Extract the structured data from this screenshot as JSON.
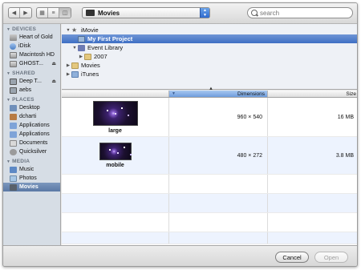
{
  "toolbar": {
    "location": "Movies",
    "search_placeholder": "search"
  },
  "sidebar": {
    "sections": [
      {
        "title": "DEVICES",
        "items": [
          {
            "label": "Heart of Gold",
            "icon": "drive-icon"
          },
          {
            "label": "iDisk",
            "icon": "idisk-icon"
          },
          {
            "label": "Macintosh HD",
            "icon": "hard-drive-icon"
          },
          {
            "label": "GHOST...",
            "icon": "hard-drive-icon",
            "eject": true
          }
        ]
      },
      {
        "title": "SHARED",
        "items": [
          {
            "label": "Deep T...",
            "icon": "network-computer-icon",
            "eject": true
          },
          {
            "label": "aebs",
            "icon": "network-icon"
          }
        ]
      },
      {
        "title": "PLACES",
        "items": [
          {
            "label": "Desktop",
            "icon": "desktop-icon"
          },
          {
            "label": "dcharti",
            "icon": "home-icon"
          },
          {
            "label": "Applications",
            "icon": "applications-icon"
          },
          {
            "label": "Applications",
            "icon": "applications-icon"
          },
          {
            "label": "Documents",
            "icon": "documents-icon"
          },
          {
            "label": "Quicksilver",
            "icon": "quicksilver-icon"
          }
        ]
      },
      {
        "title": "MEDIA",
        "items": [
          {
            "label": "Music",
            "icon": "music-icon"
          },
          {
            "label": "Photos",
            "icon": "photos-icon"
          },
          {
            "label": "Movies",
            "icon": "movies-icon",
            "selected": true
          }
        ]
      }
    ]
  },
  "tree": {
    "rows": [
      {
        "label": "iMovie",
        "indent": 0,
        "expanded": true,
        "icon": "star-icon"
      },
      {
        "label": "My First Project",
        "indent": 1,
        "selected": true,
        "icon": "project-icon"
      },
      {
        "label": "Event Library",
        "indent": 1,
        "expanded": true,
        "icon": "event-library-icon"
      },
      {
        "label": "2007",
        "indent": 2,
        "collapsed": true,
        "icon": "folder-icon"
      },
      {
        "label": "Movies",
        "indent": 0,
        "collapsed": true,
        "icon": "folder-icon"
      },
      {
        "label": "iTunes",
        "indent": 0,
        "collapsed": true,
        "icon": "itunes-icon"
      }
    ]
  },
  "table": {
    "columns": [
      "",
      "Dimensions",
      "Size"
    ],
    "sorted_column": "Dimensions",
    "rows": [
      {
        "name": "large",
        "dimensions": "960 × 540",
        "size": "16 MB"
      },
      {
        "name": "mobile",
        "dimensions": "480 × 272",
        "size": "3.8 MB"
      }
    ]
  },
  "footer": {
    "cancel_label": "Cancel",
    "open_label": "Open"
  }
}
